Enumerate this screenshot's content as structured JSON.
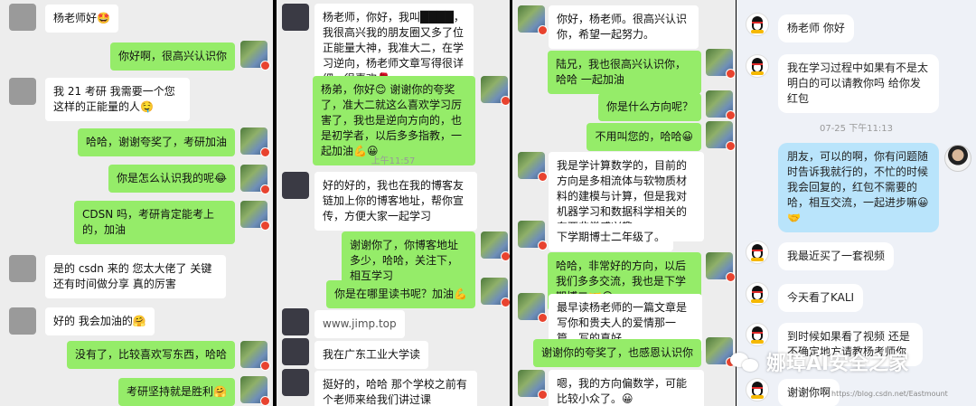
{
  "panel1": {
    "messages": [
      {
        "side": "in",
        "text": "杨老师好🤩"
      },
      {
        "side": "out",
        "text": "你好啊，很高兴认识你"
      },
      {
        "side": "in",
        "text": "我 21 考研  我需要一个您这样的正能量的人🤤"
      },
      {
        "side": "out",
        "text": "哈哈，谢谢夸奖了，考研加油"
      },
      {
        "side": "out",
        "text": "你是怎么认识我的呢😂"
      },
      {
        "side": "out",
        "text": "CDSN 吗，考研肯定能考上的，加油"
      },
      {
        "side": "in",
        "text": "是的 csdn 来的  您太大佬了  关键还有时间做分享  真的厉害"
      },
      {
        "side": "in",
        "text": "好的  我会加油的🤗"
      },
      {
        "side": "out",
        "text": "没有了，比较喜欢写东西，哈哈"
      },
      {
        "side": "out",
        "text": "考研坚持就是胜利🤗"
      }
    ]
  },
  "panel2": {
    "timestamp": "上午11:57",
    "messages": [
      {
        "side": "in",
        "text": "杨老师，你好，我叫████，我很高兴我的朋友圈又多了位正能量大神，我准大二，在学习逆向，杨老师文章写得很详细，很喜欢🌹"
      },
      {
        "side": "out",
        "text": "杨弟，你好😊 谢谢你的夸奖了，准大二就这么喜欢学习厉害了，我也是逆向方向的，也是初学者，以后多多指教，一起加油💪😀"
      },
      {
        "side": "in",
        "text": "好的好的，我也在我的博客友链加上你的博客地址，帮你宣传，方便大家一起学习"
      },
      {
        "side": "out",
        "text": "谢谢你了，你博客地址多少，哈哈，关注下，相互学习"
      },
      {
        "side": "out",
        "text": "你是在哪里读书呢？加油💪"
      },
      {
        "side": "in",
        "text": "www.jimp.top"
      },
      {
        "side": "in",
        "text": "我在广东工业大学读"
      },
      {
        "side": "in",
        "text": "挺好的，哈哈 那个学校之前有个老师来给我们讲过课"
      }
    ]
  },
  "panel3": {
    "messages": [
      {
        "side": "in",
        "text": "你好，杨老师。很高兴认识你，希望一起努力。"
      },
      {
        "side": "out",
        "text": "陆兄，我也很高兴认识你，哈哈 一起加油"
      },
      {
        "side": "out",
        "text": "你是什么方向呢？"
      },
      {
        "side": "out",
        "text": "不用叫您的，哈哈😀"
      },
      {
        "side": "in",
        "text": "我是学计算数学的，目前的方向是多相流体与软物质材料的建模与计算，但是我对机器学习和数据科学相关的东西非常感兴趣。"
      },
      {
        "side": "in",
        "text": "下学期博士二年级了。"
      },
      {
        "side": "out",
        "text": "哈哈，非常好的方向，以后我们多多交流，我也是下学期博二🤝😀"
      },
      {
        "side": "in",
        "text": "最早读杨老师的一篇文章是写你和贵夫人的爱情那一篇，写的真好。"
      },
      {
        "side": "out",
        "text": "谢谢你的夸奖了，也感恩认识你"
      },
      {
        "side": "in",
        "text": "嗯，我的方向偏数学，可能比较小众了。😀"
      }
    ]
  },
  "panel4": {
    "timestamp": "07-25 下午11:13",
    "messages": [
      {
        "side": "in",
        "text": "杨老师 你好"
      },
      {
        "side": "in",
        "text": "我在学习过程中如果有不是太明白的可以请教你吗  给你发红包"
      },
      {
        "side": "out",
        "text": "朋友，可以的啊，你有问题随时告诉我就行的，不忙的时候我会回复的，红包不需要的哈，相互交流，一起进步嘛😀🤝"
      },
      {
        "side": "in",
        "text": "我最近买了一套视频"
      },
      {
        "side": "in",
        "text": "今天看了KALI"
      },
      {
        "side": "in",
        "text": "到时候如果看了视频 还是不确定地方请教杨考师你"
      },
      {
        "side": "in",
        "text": "谢谢你啊"
      }
    ]
  },
  "watermark": {
    "text": "娜璋AI安全之家",
    "url": "https://blog.csdn.net/Eastmount"
  },
  "colors": {
    "wechat_out": "#95ec69",
    "wechat_in": "#ffffff",
    "wechat_bg": "#ededed",
    "qq_bg": "#eef1f7",
    "qq_out": "#b9e4fb"
  }
}
